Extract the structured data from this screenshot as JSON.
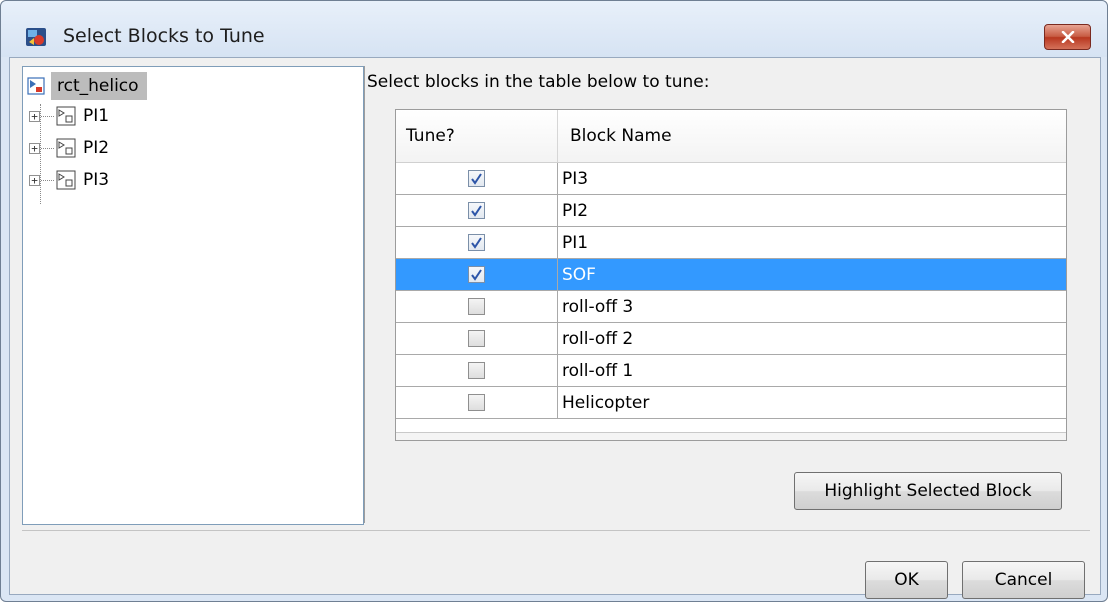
{
  "window": {
    "title": "Select Blocks to Tune",
    "close_label": "✕"
  },
  "tree": {
    "root": {
      "label": "rct_helico",
      "icon": "model-icon"
    },
    "children": [
      {
        "label": "PI1",
        "expander": "+"
      },
      {
        "label": "PI2",
        "expander": "+"
      },
      {
        "label": "PI3",
        "expander": "+"
      }
    ]
  },
  "main": {
    "instruction": "Select blocks in the table below to tune:",
    "table": {
      "headers": {
        "tune": "Tune?",
        "name": "Block Name"
      },
      "rows": [
        {
          "name": "PI3",
          "checked": true,
          "selected": false
        },
        {
          "name": "PI2",
          "checked": true,
          "selected": false
        },
        {
          "name": "PI1",
          "checked": true,
          "selected": false
        },
        {
          "name": "SOF",
          "checked": true,
          "selected": true
        },
        {
          "name": "roll-off 3",
          "checked": false,
          "selected": false
        },
        {
          "name": "roll-off 2",
          "checked": false,
          "selected": false
        },
        {
          "name": "roll-off 1",
          "checked": false,
          "selected": false
        },
        {
          "name": "Helicopter",
          "checked": false,
          "selected": false
        }
      ]
    },
    "highlight_button": "Highlight Selected Block"
  },
  "footer": {
    "ok_label": "OK",
    "cancel_label": "Cancel"
  },
  "colors": {
    "selection": "#3399ff",
    "titlebar": "#dbe6f4",
    "close_button": "#c75b43"
  }
}
